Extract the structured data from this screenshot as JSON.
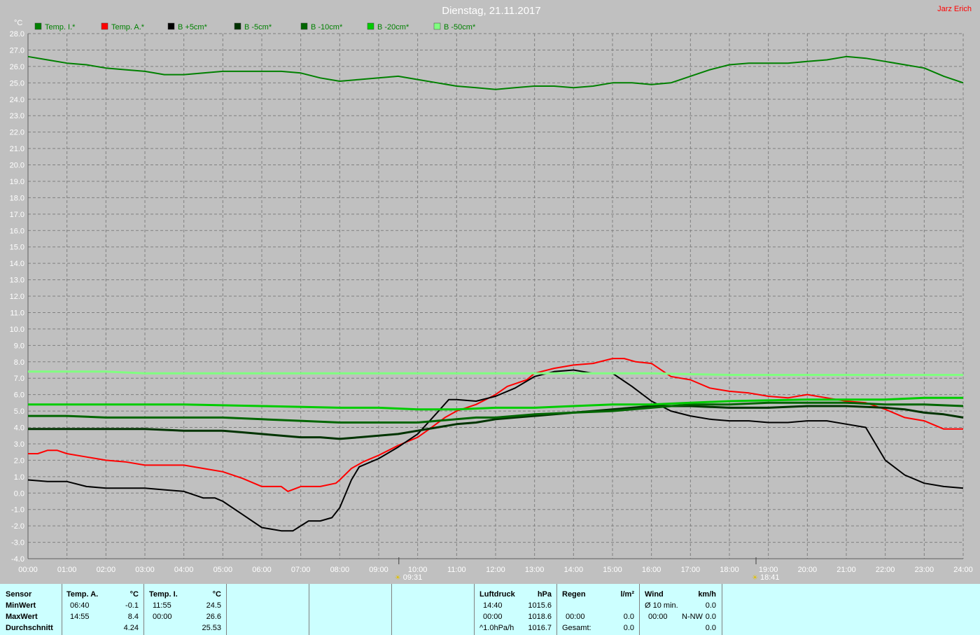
{
  "title": "Dienstag, 21.11.2017",
  "author": "Jarz Erich",
  "chart_data": {
    "type": "line",
    "ylabel": "°C",
    "ylim": [
      -4,
      28
    ],
    "xlim": [
      0,
      24
    ],
    "y_ticks": [
      "-4.0",
      "-3.0",
      "-2.0",
      "-1.0",
      "0.0",
      "1.0",
      "2.0",
      "3.0",
      "4.0",
      "5.0",
      "6.0",
      "7.0",
      "8.0",
      "9.0",
      "10.0",
      "11.0",
      "12.0",
      "13.0",
      "14.0",
      "15.0",
      "16.0",
      "17.0",
      "18.0",
      "19.0",
      "20.0",
      "21.0",
      "22.0",
      "23.0",
      "24.0",
      "25.0",
      "26.0",
      "27.0",
      "28.0"
    ],
    "x_ticks": [
      "00:00",
      "01:00",
      "02:00",
      "03:00",
      "04:00",
      "05:00",
      "06:00",
      "07:00",
      "08:00",
      "09:00",
      "10:00",
      "11:00",
      "12:00",
      "13:00",
      "14:00",
      "15:00",
      "16:00",
      "17:00",
      "18:00",
      "19:00",
      "20:00",
      "21:00",
      "22:00",
      "23:00",
      "24:00"
    ],
    "grid": true,
    "legend_position": "top-left",
    "markers": [
      {
        "label": "09:31",
        "x": 9.517,
        "icon": "sunrise-icon"
      },
      {
        "label": "18:41",
        "x": 18.683,
        "icon": "sunset-icon"
      }
    ],
    "series": [
      {
        "name": "Temp. I.*",
        "color": "#008000",
        "width": 2,
        "points": [
          [
            0,
            26.6
          ],
          [
            0.5,
            26.4
          ],
          [
            1,
            26.2
          ],
          [
            1.5,
            26.1
          ],
          [
            2,
            25.9
          ],
          [
            2.5,
            25.8
          ],
          [
            3,
            25.7
          ],
          [
            3.5,
            25.5
          ],
          [
            4,
            25.5
          ],
          [
            4.5,
            25.6
          ],
          [
            5,
            25.7
          ],
          [
            5.5,
            25.7
          ],
          [
            6,
            25.7
          ],
          [
            6.5,
            25.7
          ],
          [
            7,
            25.6
          ],
          [
            7.5,
            25.3
          ],
          [
            8,
            25.1
          ],
          [
            8.5,
            25.2
          ],
          [
            9,
            25.3
          ],
          [
            9.5,
            25.4
          ],
          [
            10,
            25.2
          ],
          [
            10.5,
            25.0
          ],
          [
            11,
            24.8
          ],
          [
            11.5,
            24.7
          ],
          [
            12,
            24.6
          ],
          [
            12.5,
            24.7
          ],
          [
            13,
            24.8
          ],
          [
            13.5,
            24.8
          ],
          [
            14,
            24.7
          ],
          [
            14.5,
            24.8
          ],
          [
            15,
            25.0
          ],
          [
            15.5,
            25.0
          ],
          [
            16,
            24.9
          ],
          [
            16.5,
            25.0
          ],
          [
            17,
            25.4
          ],
          [
            17.5,
            25.8
          ],
          [
            18,
            26.1
          ],
          [
            18.5,
            26.2
          ],
          [
            19,
            26.2
          ],
          [
            19.5,
            26.2
          ],
          [
            20,
            26.3
          ],
          [
            20.5,
            26.4
          ],
          [
            21,
            26.6
          ],
          [
            21.5,
            26.5
          ],
          [
            22,
            26.3
          ],
          [
            22.5,
            26.1
          ],
          [
            23,
            25.9
          ],
          [
            23.5,
            25.4
          ],
          [
            24,
            25.0
          ]
        ]
      },
      {
        "name": "Temp. A.*",
        "color": "#ff0000",
        "width": 2,
        "points": [
          [
            0,
            2.4
          ],
          [
            0.25,
            2.4
          ],
          [
            0.5,
            2.6
          ],
          [
            0.75,
            2.6
          ],
          [
            1,
            2.4
          ],
          [
            1.5,
            2.2
          ],
          [
            2,
            2.0
          ],
          [
            2.5,
            1.9
          ],
          [
            3,
            1.7
          ],
          [
            3.5,
            1.7
          ],
          [
            4,
            1.7
          ],
          [
            4.5,
            1.5
          ],
          [
            5,
            1.3
          ],
          [
            5.5,
            0.9
          ],
          [
            6,
            0.4
          ],
          [
            6.5,
            0.4
          ],
          [
            6.67,
            0.1
          ],
          [
            7,
            0.4
          ],
          [
            7.5,
            0.4
          ],
          [
            7.9,
            0.6
          ],
          [
            8,
            0.8
          ],
          [
            8.3,
            1.5
          ],
          [
            8.6,
            1.9
          ],
          [
            9,
            2.3
          ],
          [
            9.5,
            2.9
          ],
          [
            10,
            3.4
          ],
          [
            10.3,
            3.9
          ],
          [
            10.7,
            4.6
          ],
          [
            11,
            5.0
          ],
          [
            11.5,
            5.4
          ],
          [
            12,
            6.0
          ],
          [
            12.3,
            6.5
          ],
          [
            12.8,
            6.9
          ],
          [
            13,
            7.3
          ],
          [
            13.5,
            7.6
          ],
          [
            14,
            7.8
          ],
          [
            14.5,
            7.9
          ],
          [
            15,
            8.2
          ],
          [
            15.3,
            8.2
          ],
          [
            15.6,
            8.0
          ],
          [
            16,
            7.9
          ],
          [
            16.5,
            7.1
          ],
          [
            17,
            6.9
          ],
          [
            17.5,
            6.4
          ],
          [
            18,
            6.2
          ],
          [
            18.5,
            6.1
          ],
          [
            19,
            5.9
          ],
          [
            19.5,
            5.8
          ],
          [
            20,
            6.0
          ],
          [
            20.5,
            5.8
          ],
          [
            21,
            5.6
          ],
          [
            21.5,
            5.5
          ],
          [
            22,
            5.1
          ],
          [
            22.5,
            4.6
          ],
          [
            23,
            4.4
          ],
          [
            23.5,
            3.9
          ],
          [
            24,
            3.9
          ]
        ]
      },
      {
        "name": "B +5cm*",
        "color": "#000000",
        "width": 2,
        "points": [
          [
            0,
            0.8
          ],
          [
            0.5,
            0.7
          ],
          [
            1,
            0.7
          ],
          [
            1.5,
            0.4
          ],
          [
            2,
            0.3
          ],
          [
            2.5,
            0.3
          ],
          [
            3,
            0.3
          ],
          [
            3.5,
            0.2
          ],
          [
            4,
            0.1
          ],
          [
            4.5,
            -0.3
          ],
          [
            4.8,
            -0.3
          ],
          [
            5,
            -0.5
          ],
          [
            5.5,
            -1.3
          ],
          [
            6,
            -2.1
          ],
          [
            6.5,
            -2.3
          ],
          [
            6.8,
            -2.3
          ],
          [
            7,
            -2.0
          ],
          [
            7.2,
            -1.7
          ],
          [
            7.5,
            -1.7
          ],
          [
            7.8,
            -1.5
          ],
          [
            8,
            -0.9
          ],
          [
            8.3,
            0.8
          ],
          [
            8.5,
            1.6
          ],
          [
            8.8,
            1.9
          ],
          [
            9,
            2.1
          ],
          [
            9.5,
            2.8
          ],
          [
            10,
            3.6
          ],
          [
            10.5,
            4.9
          ],
          [
            10.8,
            5.7
          ],
          [
            11,
            5.7
          ],
          [
            11.5,
            5.6
          ],
          [
            12,
            5.9
          ],
          [
            12.5,
            6.4
          ],
          [
            13,
            7.1
          ],
          [
            13.5,
            7.4
          ],
          [
            14,
            7.5
          ],
          [
            14.5,
            7.3
          ],
          [
            15,
            7.3
          ],
          [
            15.5,
            6.5
          ],
          [
            16,
            5.6
          ],
          [
            16.5,
            5.0
          ],
          [
            17,
            4.7
          ],
          [
            17.5,
            4.5
          ],
          [
            18,
            4.4
          ],
          [
            18.5,
            4.4
          ],
          [
            19,
            4.3
          ],
          [
            19.5,
            4.3
          ],
          [
            20,
            4.4
          ],
          [
            20.5,
            4.4
          ],
          [
            21,
            4.2
          ],
          [
            21.5,
            4.0
          ],
          [
            22,
            2.0
          ],
          [
            22.5,
            1.1
          ],
          [
            23,
            0.6
          ],
          [
            23.5,
            0.4
          ],
          [
            24,
            0.3
          ]
        ]
      },
      {
        "name": "B -5cm*",
        "color": "#003300",
        "width": 3,
        "points": [
          [
            0,
            3.9
          ],
          [
            1,
            3.9
          ],
          [
            2,
            3.9
          ],
          [
            3,
            3.9
          ],
          [
            4,
            3.8
          ],
          [
            5,
            3.8
          ],
          [
            5.5,
            3.7
          ],
          [
            6,
            3.6
          ],
          [
            6.5,
            3.5
          ],
          [
            7,
            3.4
          ],
          [
            7.5,
            3.4
          ],
          [
            8,
            3.3
          ],
          [
            8.5,
            3.4
          ],
          [
            9,
            3.5
          ],
          [
            9.5,
            3.6
          ],
          [
            10,
            3.8
          ],
          [
            10.5,
            4.0
          ],
          [
            11,
            4.2
          ],
          [
            11.5,
            4.3
          ],
          [
            12,
            4.5
          ],
          [
            12.5,
            4.6
          ],
          [
            13,
            4.7
          ],
          [
            13.5,
            4.8
          ],
          [
            14,
            4.9
          ],
          [
            14.5,
            5.0
          ],
          [
            15,
            5.1
          ],
          [
            15.5,
            5.2
          ],
          [
            16,
            5.3
          ],
          [
            17,
            5.3
          ],
          [
            18,
            5.2
          ],
          [
            19,
            5.2
          ],
          [
            20,
            5.3
          ],
          [
            21,
            5.3
          ],
          [
            22,
            5.2
          ],
          [
            22.5,
            5.1
          ],
          [
            23,
            4.9
          ],
          [
            23.5,
            4.8
          ],
          [
            24,
            4.6
          ]
        ]
      },
      {
        "name": "B -10cm*",
        "color": "#006600",
        "width": 3,
        "points": [
          [
            0,
            4.7
          ],
          [
            1,
            4.7
          ],
          [
            2,
            4.6
          ],
          [
            3,
            4.6
          ],
          [
            4,
            4.6
          ],
          [
            5,
            4.6
          ],
          [
            6,
            4.5
          ],
          [
            7,
            4.4
          ],
          [
            8,
            4.3
          ],
          [
            9,
            4.3
          ],
          [
            10,
            4.3
          ],
          [
            10.5,
            4.4
          ],
          [
            11,
            4.5
          ],
          [
            11.5,
            4.6
          ],
          [
            12,
            4.6
          ],
          [
            12.5,
            4.7
          ],
          [
            13,
            4.8
          ],
          [
            14,
            4.9
          ],
          [
            15,
            5.0
          ],
          [
            16,
            5.2
          ],
          [
            17,
            5.4
          ],
          [
            18,
            5.4
          ],
          [
            19,
            5.5
          ],
          [
            20,
            5.5
          ],
          [
            21,
            5.5
          ],
          [
            22,
            5.4
          ],
          [
            23,
            5.4
          ],
          [
            24,
            5.3
          ]
        ]
      },
      {
        "name": "B -20cm*",
        "color": "#00cc00",
        "width": 3,
        "points": [
          [
            0,
            5.4
          ],
          [
            2,
            5.4
          ],
          [
            4,
            5.4
          ],
          [
            6,
            5.3
          ],
          [
            8,
            5.2
          ],
          [
            9,
            5.2
          ],
          [
            10,
            5.1
          ],
          [
            11,
            5.1
          ],
          [
            12,
            5.2
          ],
          [
            13,
            5.2
          ],
          [
            14,
            5.3
          ],
          [
            15,
            5.4
          ],
          [
            16,
            5.4
          ],
          [
            17,
            5.5
          ],
          [
            18,
            5.6
          ],
          [
            20,
            5.7
          ],
          [
            22,
            5.7
          ],
          [
            23,
            5.8
          ],
          [
            24,
            5.8
          ]
        ]
      },
      {
        "name": "B -50cm*",
        "color": "#80ff80",
        "width": 3,
        "points": [
          [
            0,
            7.4
          ],
          [
            2,
            7.4
          ],
          [
            3,
            7.3
          ],
          [
            6,
            7.3
          ],
          [
            10,
            7.3
          ],
          [
            14,
            7.3
          ],
          [
            16,
            7.3
          ],
          [
            18,
            7.2
          ],
          [
            20,
            7.2
          ],
          [
            24,
            7.2
          ]
        ]
      }
    ]
  },
  "stats": {
    "sensor": {
      "header": "Sensor",
      "rows": [
        "MinWert",
        "MaxWert",
        "Durchschnitt"
      ]
    },
    "temp_a": {
      "header": "Temp. A.",
      "unit": "°C",
      "min_time": "06:40",
      "min_val": "-0.1",
      "max_time": "14:55",
      "max_val": "8.4",
      "avg": "4.24"
    },
    "temp_i": {
      "header": "Temp. I.",
      "unit": "°C",
      "min_time": "11:55",
      "min_val": "24.5",
      "max_time": "00:00",
      "max_val": "26.6",
      "avg": "25.53"
    },
    "luftdruck": {
      "header": "Luftdruck",
      "unit": "hPa",
      "min_time": "14:40",
      "min_val": "1015.6",
      "max_time": "00:00",
      "max_val": "1018.6",
      "trend": "^1.0hPa/h",
      "current": "1016.7"
    },
    "regen": {
      "header": "Regen",
      "unit": "l/m²",
      "time": "00:00",
      "val": "0.0",
      "total_label": "Gesamt:",
      "total": "0.0"
    },
    "wind": {
      "header": "Wind",
      "unit": "km/h",
      "avg_label": "Ø 10 min.",
      "avg_val": "0.0",
      "max_time": "00:00",
      "max_dir": "N-NW",
      "max_val": "0.0",
      "third_val": "0.0"
    }
  }
}
